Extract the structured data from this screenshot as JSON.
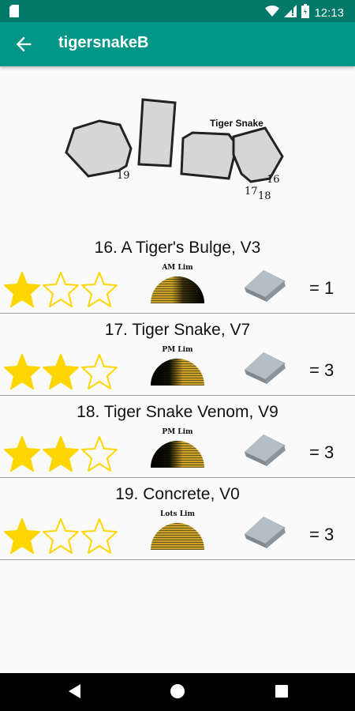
{
  "status_bar": {
    "time": "12:13",
    "battery_level": "battery-icon"
  },
  "app_bar": {
    "title": "tigersnakeB",
    "back_icon": "arrow-left-icon"
  },
  "topo": {
    "label": "Tiger Snake",
    "numbers": [
      "19",
      "16",
      "17",
      "18"
    ]
  },
  "routes": [
    {
      "title": "16. A Tiger's Bulge, V3",
      "stars": 1,
      "max_stars": 3,
      "sun_label": "AM Lim",
      "sun_type": "am",
      "count": "= 1"
    },
    {
      "title": "17. Tiger Snake, V7",
      "stars": 2,
      "max_stars": 3,
      "sun_label": "PM Lim",
      "sun_type": "pm",
      "count": "= 3"
    },
    {
      "title": "18. Tiger Snake Venom, V9",
      "stars": 2,
      "max_stars": 3,
      "sun_label": "PM Lim",
      "sun_type": "pm",
      "count": "= 3"
    },
    {
      "title": "19. Concrete, V0",
      "stars": 1,
      "max_stars": 3,
      "sun_label": "Lots Lim",
      "sun_type": "lots",
      "count": "= 3"
    }
  ],
  "colors": {
    "status_bar": "#00796b",
    "app_bar": "#009688",
    "star": "#ffd600",
    "boulder": "#d6d6d6",
    "sun_gold": "#c9a227"
  }
}
